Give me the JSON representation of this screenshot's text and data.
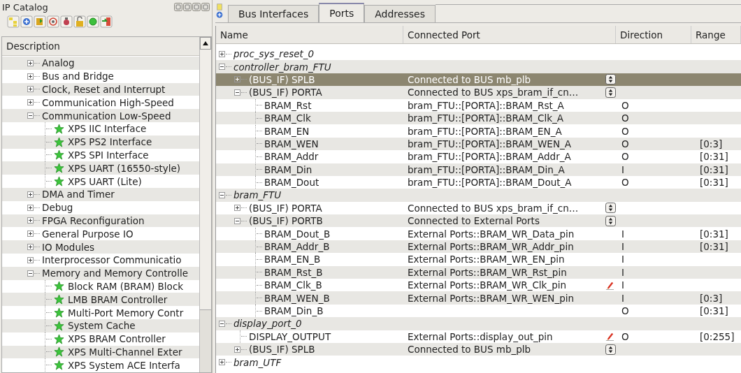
{
  "catalog": {
    "title": "IP Catalog",
    "header": "Description",
    "categories": [
      {
        "label": "Analog",
        "expanded": false
      },
      {
        "label": "Bus and Bridge",
        "expanded": false
      },
      {
        "label": "Clock, Reset and Interrupt",
        "expanded": false
      },
      {
        "label": "Communication High-Speed",
        "expanded": false
      },
      {
        "label": "Communication Low-Speed",
        "expanded": true,
        "children": [
          {
            "label": "XPS IIC Interface"
          },
          {
            "label": "XPS PS2 Interface"
          },
          {
            "label": "XPS SPI Interface"
          },
          {
            "label": "XPS UART (16550-style)"
          },
          {
            "label": "XPS UART (Lite)"
          }
        ]
      },
      {
        "label": "DMA and Timer",
        "expanded": false
      },
      {
        "label": "Debug",
        "expanded": false
      },
      {
        "label": "FPGA Reconfiguration",
        "expanded": false
      },
      {
        "label": "General Purpose IO",
        "expanded": false
      },
      {
        "label": "IO Modules",
        "expanded": false
      },
      {
        "label": "Interprocessor Communicatio",
        "expanded": false
      },
      {
        "label": "Memory and Memory Controlle",
        "expanded": true,
        "children": [
          {
            "label": "Block RAM (BRAM) Block"
          },
          {
            "label": "LMB BRAM Controller"
          },
          {
            "label": "Multi-Port Memory Contr"
          },
          {
            "label": "System Cache"
          },
          {
            "label": "XPS BRAM Controller"
          },
          {
            "label": "XPS Multi-Channel Exter"
          },
          {
            "label": "XPS System ACE Interfa"
          }
        ]
      }
    ]
  },
  "tabs": [
    {
      "label": "Bus Interfaces",
      "selected": false
    },
    {
      "label": "Ports",
      "selected": true
    },
    {
      "label": "Addresses",
      "selected": false
    }
  ],
  "columns": [
    "Name",
    "Connected Port",
    "Direction",
    "Range"
  ],
  "rows": [
    {
      "name": "proc_sys_reset_0",
      "expanded": false
    },
    {
      "name": "controller_bram_FTU",
      "expanded": true,
      "children": [
        {
          "name": "(BUS_IF) SPLB",
          "expanded": false,
          "selected": true,
          "connection": "Connected to BUS mb_plb",
          "dropdown": true
        },
        {
          "name": "(BUS_IF) PORTA",
          "expanded": true,
          "selected": false,
          "connection": "Connected to BUS xps_bram_if_cn…",
          "dropdown": true,
          "children": [
            {
              "name": "BRAM_Rst",
              "connection": "bram_FTU::[PORTA]::BRAM_Rst_A",
              "direction": "O"
            },
            {
              "name": "BRAM_Clk",
              "connection": "bram_FTU::[PORTA]::BRAM_Clk_A",
              "direction": "O"
            },
            {
              "name": "BRAM_EN",
              "connection": "bram_FTU::[PORTA]::BRAM_EN_A",
              "direction": "O"
            },
            {
              "name": "BRAM_WEN",
              "connection": "bram_FTU::[PORTA]::BRAM_WEN_A",
              "direction": "O",
              "range": "[0:3]"
            },
            {
              "name": "BRAM_Addr",
              "connection": "bram_FTU::[PORTA]::BRAM_Addr_A",
              "direction": "O",
              "range": "[0:31]"
            },
            {
              "name": "BRAM_Din",
              "connection": "bram_FTU::[PORTA]::BRAM_Din_A",
              "direction": "I",
              "range": "[0:31]"
            },
            {
              "name": "BRAM_Dout",
              "connection": "bram_FTU::[PORTA]::BRAM_Dout_A",
              "direction": "O",
              "range": "[0:31]"
            }
          ]
        }
      ]
    },
    {
      "name": "bram_FTU",
      "expanded": true,
      "children": [
        {
          "name": "(BUS_IF) PORTA",
          "expanded": false,
          "selected": false,
          "connection": "Connected to BUS xps_bram_if_cn…",
          "dropdown": true
        },
        {
          "name": "(BUS_IF) PORTB",
          "expanded": true,
          "selected": false,
          "connection": "Connected to External Ports",
          "dropdown": true,
          "children": [
            {
              "name": "BRAM_Dout_B",
              "connection": "External Ports::BRAM_WR_Data_pin",
              "direction": "I",
              "range": "[0:31]"
            },
            {
              "name": "BRAM_Addr_B",
              "connection": "External Ports::BRAM_WR_Addr_pin",
              "direction": "I",
              "range": "[0:31]"
            },
            {
              "name": "BRAM_EN_B",
              "connection": "External Ports::BRAM_WR_EN_pin",
              "direction": "I"
            },
            {
              "name": "BRAM_Rst_B",
              "connection": "External Ports::BRAM_WR_Rst_pin",
              "direction": "I"
            },
            {
              "name": "BRAM_Clk_B",
              "connection": "External Ports::BRAM_WR_Clk_pin",
              "direction": "I",
              "edited": true
            },
            {
              "name": "BRAM_WEN_B",
              "connection": "External Ports::BRAM_WR_WEN_pin",
              "direction": "I",
              "range": "[0:3]"
            },
            {
              "name": "BRAM_Din_B",
              "direction": "O",
              "range": "[0:31]"
            }
          ]
        }
      ]
    },
    {
      "name": "display_port_0",
      "expanded": true,
      "children": [
        {
          "name": "DISPLAY_OUTPUT",
          "connection": "External Ports::display_out_pin",
          "direction": "O",
          "range": "[0:255]",
          "edited": true
        },
        {
          "name": "(BUS_IF) SPLB",
          "expanded": false,
          "selected": false,
          "connection": "Connected to BUS mb_plb",
          "dropdown": true
        }
      ]
    },
    {
      "name": "bram_UTF",
      "expanded": false
    }
  ]
}
